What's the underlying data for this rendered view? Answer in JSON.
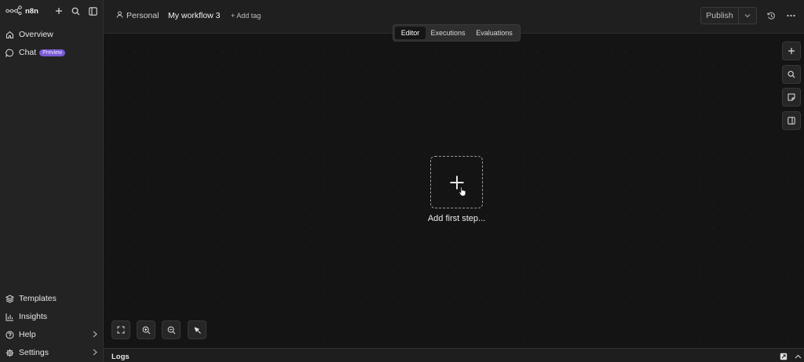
{
  "app": {
    "logo_text": "n8n"
  },
  "sidebar": {
    "top_items": [
      {
        "label": "Overview",
        "icon": "home-icon"
      },
      {
        "label": "Chat",
        "icon": "chat-icon",
        "badge": "Preview"
      }
    ],
    "bottom_items": [
      {
        "label": "Templates",
        "icon": "templates-icon"
      },
      {
        "label": "Insights",
        "icon": "insights-icon"
      },
      {
        "label": "Help",
        "icon": "help-icon"
      },
      {
        "label": "Settings",
        "icon": "settings-icon"
      }
    ]
  },
  "header": {
    "project": "Personal",
    "workflow_name": "My workflow 3",
    "add_tag": "+ Add tag",
    "publish_label": "Publish"
  },
  "tabs": [
    {
      "label": "Editor",
      "active": true
    },
    {
      "label": "Executions",
      "active": false
    },
    {
      "label": "Evaluations",
      "active": false
    }
  ],
  "canvas": {
    "add_first_step": "Add first step..."
  },
  "logs": {
    "label": "Logs"
  },
  "colors": {
    "accent_badge": "#7a5bd6",
    "canvas_bg": "#141414",
    "sidebar_bg": "#232323"
  }
}
